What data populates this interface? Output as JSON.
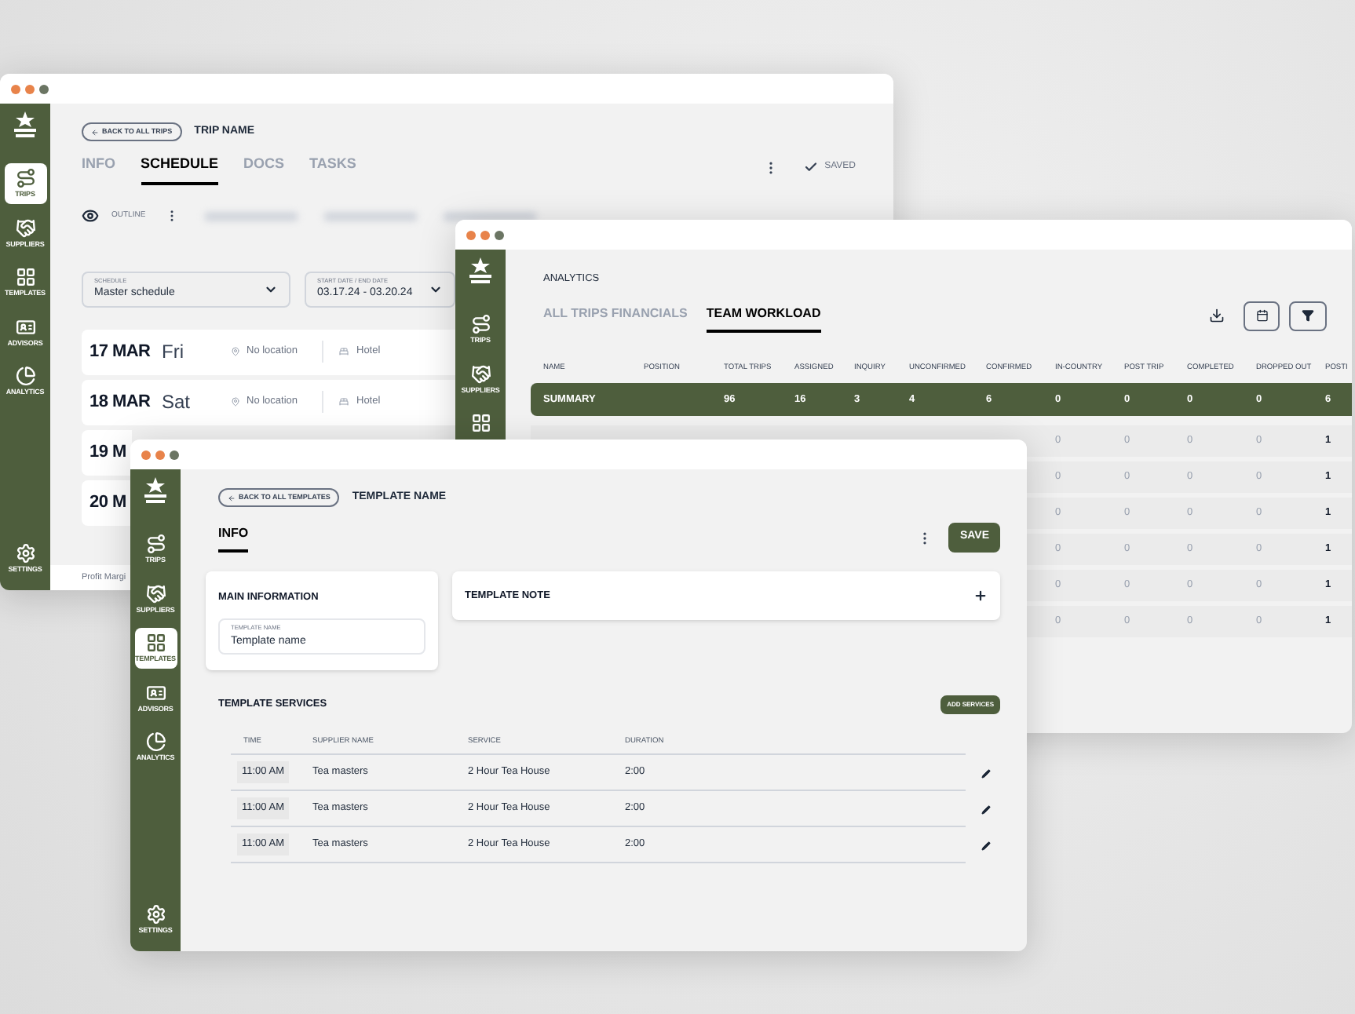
{
  "trip_window": {
    "sidebar": {
      "items": [
        {
          "kind": "trips",
          "label": "TRIPS",
          "selected": true
        },
        {
          "kind": "suppliers",
          "label": "SUPPLIERS",
          "selected": false
        },
        {
          "kind": "templates",
          "label": "TEMPLATES",
          "selected": false
        },
        {
          "kind": "advisors",
          "label": "ADVISORS",
          "selected": false
        },
        {
          "kind": "analytics",
          "label": "ANALYTICS",
          "selected": false
        }
      ],
      "footer": {
        "kind": "settings",
        "label": "SETTINGS",
        "selected": false
      }
    },
    "back_button": "BACK TO ALL TRIPS",
    "title": "TRIP NAME",
    "tabs": [
      {
        "label": "INFO",
        "selected": false
      },
      {
        "label": "SCHEDULE",
        "selected": true
      },
      {
        "label": "DOCS",
        "selected": false
      },
      {
        "label": "TASKS",
        "selected": false
      }
    ],
    "status": "SAVED",
    "view": "OUTLINE",
    "schedule_select": {
      "label": "SCHEDULE",
      "value": "Master schedule"
    },
    "date_select": {
      "label": "START DATE / END DATE",
      "value": "03.17.24 - 03.20.24"
    },
    "days": [
      {
        "date": "17 MAR",
        "weekday": "Fri",
        "location": "No location",
        "lodging": "Hotel"
      },
      {
        "date": "18 MAR",
        "weekday": "Sat",
        "location": "No location",
        "lodging": "Hotel"
      },
      {
        "date": "19 M"
      },
      {
        "date": "20 M"
      }
    ],
    "footer": "Profit Margi"
  },
  "analytics_window": {
    "sidebar": {
      "items": [
        {
          "kind": "trips",
          "label": "TRIPS",
          "selected": false
        },
        {
          "kind": "suppliers",
          "label": "SUPPLIERS",
          "selected": false
        },
        {
          "kind": "templates",
          "selected": false
        }
      ]
    },
    "title": "ANALYTICS",
    "tabs": [
      {
        "label": "ALL TRIPS FINANCIALS",
        "selected": false
      },
      {
        "label": "TEAM WORKLOAD",
        "selected": true
      }
    ],
    "columns": [
      "NAME",
      "POSITION",
      "TOTAL TRIPS",
      "ASSIGNED",
      "INQUIRY",
      "UNCONFIRMED",
      "CONFIRMED",
      "IN-COUNTRY",
      "POST TRIP",
      "COMPLETED",
      "DROPPED OUT",
      "POSTI"
    ],
    "summary": {
      "label": "SUMMARY",
      "values": [
        "96",
        "16",
        "3",
        "4",
        "6",
        "0",
        "0",
        "0",
        "0",
        "6"
      ]
    },
    "rows": [
      {
        "values": [
          "0",
          "0",
          "0",
          "0",
          "1"
        ]
      },
      {
        "values": [
          "0",
          "0",
          "0",
          "0",
          "1"
        ]
      },
      {
        "values": [
          "0",
          "0",
          "0",
          "0",
          "1"
        ]
      },
      {
        "values": [
          "0",
          "0",
          "0",
          "0",
          "1"
        ]
      },
      {
        "values": [
          "0",
          "0",
          "0",
          "0",
          "1"
        ]
      },
      {
        "values": [
          "0",
          "0",
          "0",
          "0",
          "1"
        ]
      }
    ]
  },
  "template_window": {
    "sidebar": {
      "items": [
        {
          "kind": "trips",
          "label": "TRIPS",
          "selected": false
        },
        {
          "kind": "suppliers",
          "label": "SUPPLIERS",
          "selected": false
        },
        {
          "kind": "templates",
          "label": "TEMPLATES",
          "selected": true
        },
        {
          "kind": "advisors",
          "label": "ADVISORS",
          "selected": false
        },
        {
          "kind": "analytics",
          "label": "ANALYTICS",
          "selected": false
        }
      ],
      "footer": {
        "kind": "settings",
        "label": "SETTINGS",
        "selected": false
      }
    },
    "back_button": "BACK TO ALL TEMPLATES",
    "title": "TEMPLATE NAME",
    "tabs": [
      {
        "label": "INFO",
        "selected": true
      }
    ],
    "save_button": "SAVE",
    "main_card": {
      "title": "MAIN INFORMATION",
      "field": {
        "label": "TEMPLATE NAME",
        "value": "Template name"
      }
    },
    "note_card": {
      "title": "TEMPLATE NOTE"
    },
    "services": {
      "title": "TEMPLATE SERVICES",
      "add_button": "ADD SERVICES",
      "columns": [
        "TIME",
        "SUPPLIER NAME",
        "SERVICE",
        "DURATION"
      ],
      "rows": [
        {
          "time": "11:00 AM",
          "supplier": "Tea masters",
          "service": "2 Hour Tea House",
          "duration": "2:00"
        },
        {
          "time": "11:00 AM",
          "supplier": "Tea masters",
          "service": "2 Hour Tea House",
          "duration": "2:00"
        },
        {
          "time": "11:00 AM",
          "supplier": "Tea masters",
          "service": "2 Hour Tea House",
          "duration": "2:00"
        }
      ]
    }
  }
}
